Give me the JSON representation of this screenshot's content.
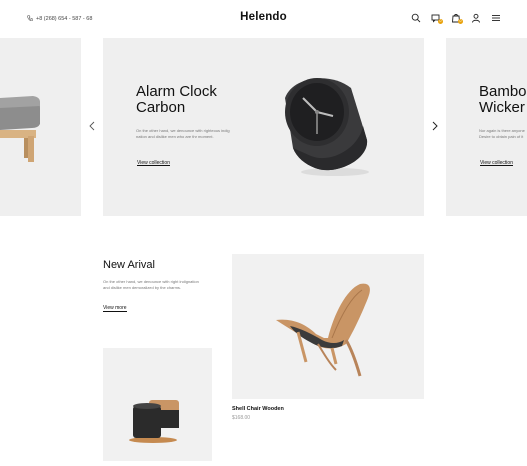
{
  "header": {
    "phone": "+8 (268) 654 - 587 - 68",
    "brand": "Helendo",
    "compare_badge": "0",
    "cart_badge": "0"
  },
  "slider": {
    "main": {
      "title_line1": "Alarm Clock",
      "title_line2": "Carbon",
      "desc_line1": "On the other hand, we denounce with righteous indig",
      "desc_line2": "nation and dislike men who are thr moment.",
      "link": "View collection"
    },
    "right": {
      "title_line1": "Bamboo",
      "title_line2": "Wicker",
      "desc_line1": "Nor again is there anyone",
      "desc_line2": "Desire to obtain pain of it",
      "link": "View collection"
    }
  },
  "new_arrival": {
    "title": "New Arival",
    "desc_line1": "On the other hand, we denounce with right indignation",
    "desc_line2": "and dislike men demoralized by the charms.",
    "link": "View more"
  },
  "products": [
    {
      "name": "Shell Chair Wooden",
      "price": "$168.00"
    }
  ],
  "colors": {
    "badge": "#e8a10a",
    "panel": "#efefef",
    "text_dark": "#111111",
    "text_muted": "#777777"
  },
  "icons": [
    "phone-icon",
    "search-icon",
    "compare-icon",
    "cart-icon",
    "user-icon",
    "menu-icon",
    "chevron-left-icon",
    "chevron-right-icon"
  ]
}
